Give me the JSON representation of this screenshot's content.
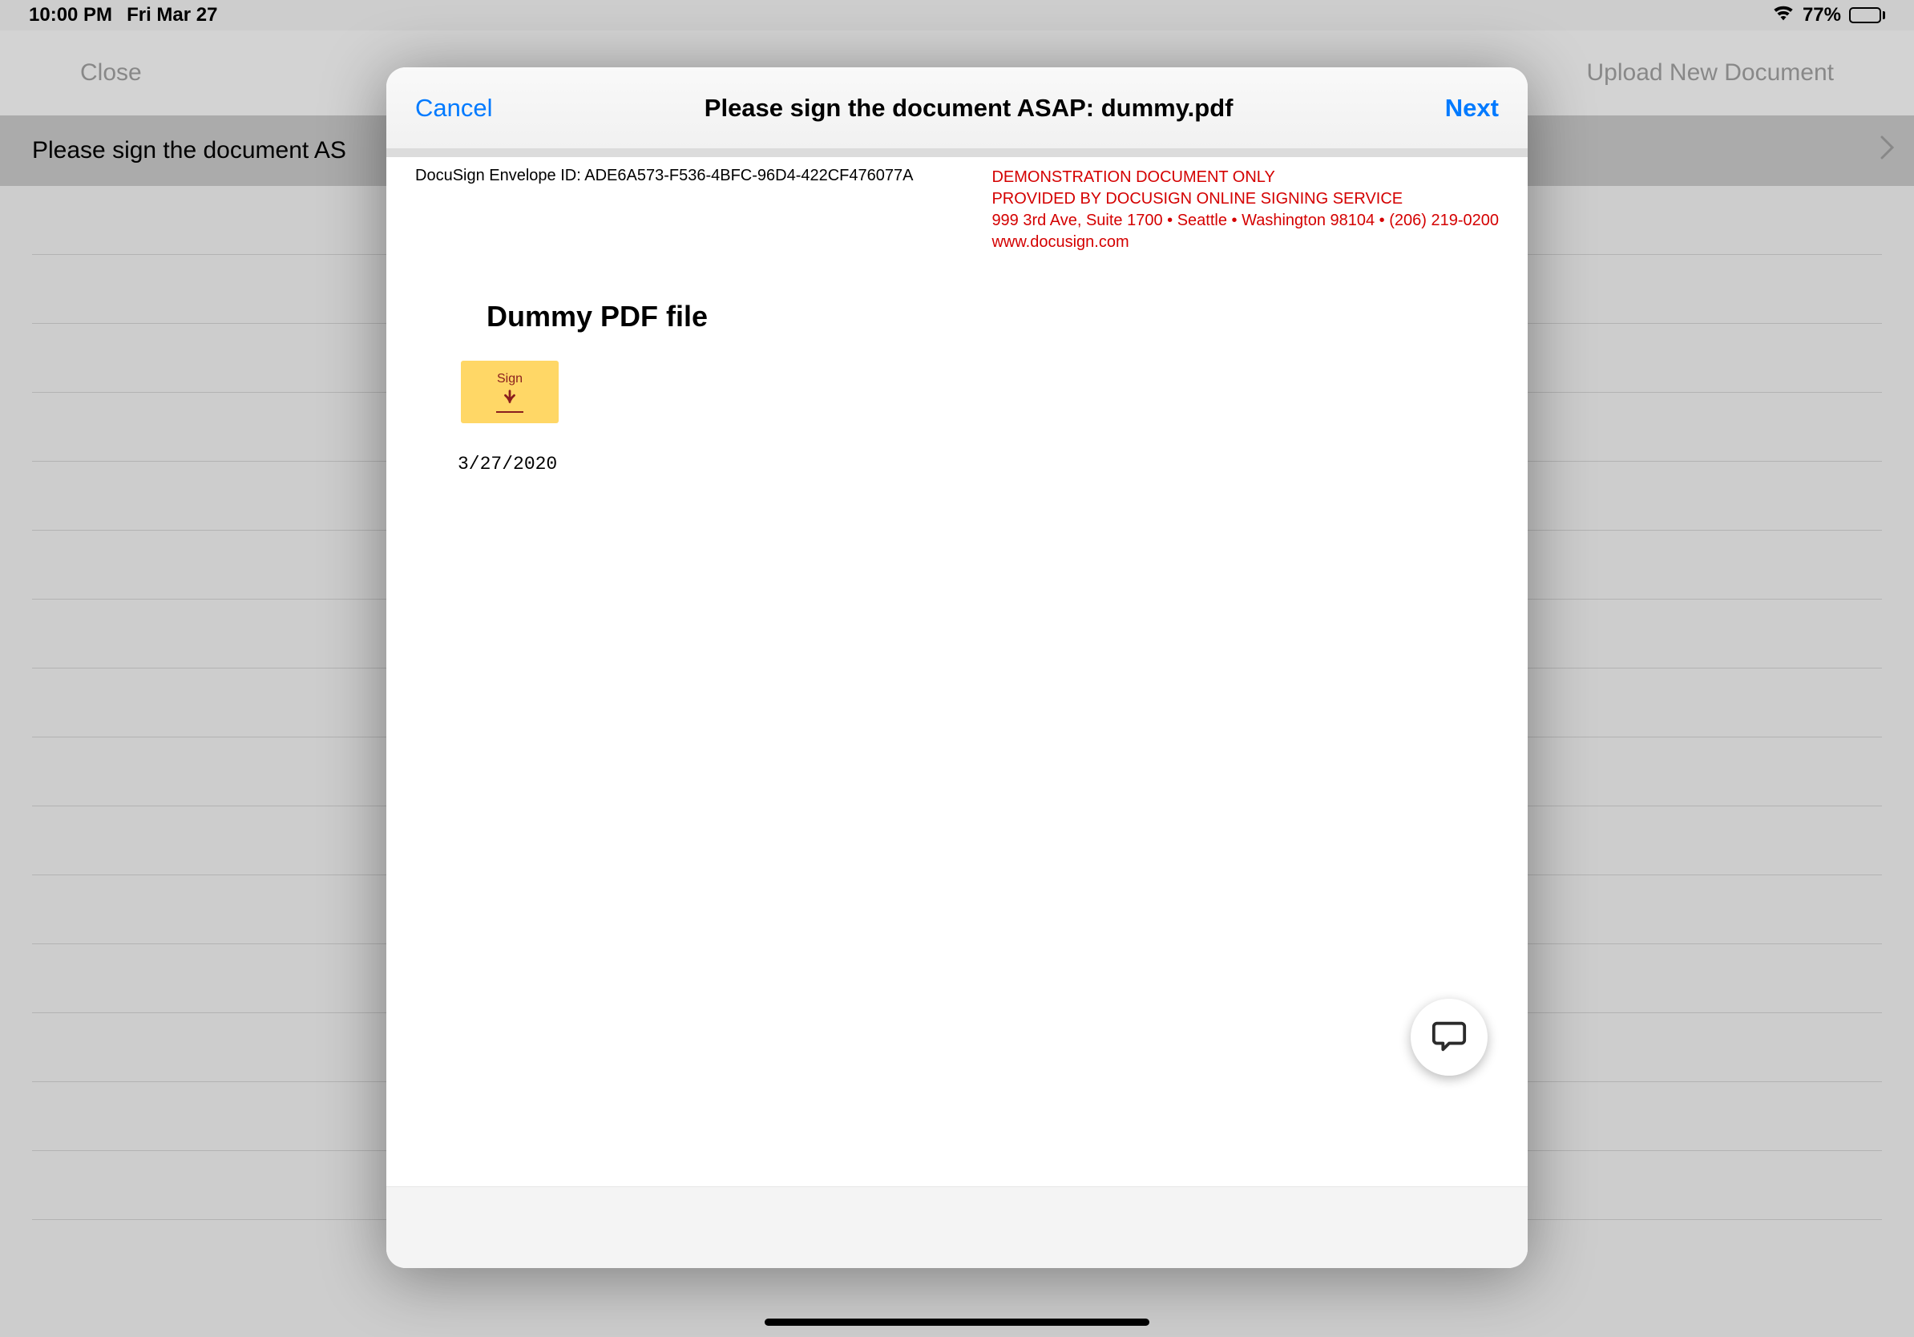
{
  "status": {
    "time": "10:00 PM",
    "date": "Fri Mar 27",
    "battery_pct": "77%"
  },
  "bg": {
    "close": "Close",
    "upload": "Upload New Document",
    "list_header": "Please sign the document AS"
  },
  "modal": {
    "cancel": "Cancel",
    "title": "Please sign the document ASAP: dummy.pdf",
    "next": "Next",
    "envelope_id": "DocuSign Envelope ID: ADE6A573-F536-4BFC-96D4-422CF476077A",
    "demo_line1": "DEMONSTRATION DOCUMENT ONLY",
    "demo_line2": "PROVIDED BY DOCUSIGN ONLINE SIGNING SERVICE",
    "demo_line3": "999 3rd Ave, Suite 1700  • Seattle • Washington 98104 • (206) 219-0200",
    "demo_line4": "www.docusign.com",
    "doc_title": "Dummy PDF file",
    "sign_label": "Sign",
    "doc_date": "3/27/2020"
  }
}
